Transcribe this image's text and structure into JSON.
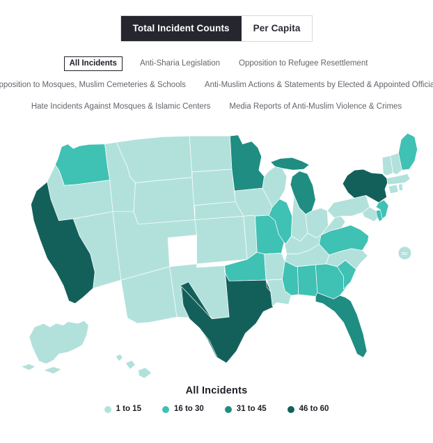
{
  "toggle": {
    "options": [
      {
        "label": "Total Incident Counts",
        "active": true
      },
      {
        "label": "Per Capita",
        "active": false
      }
    ]
  },
  "filters": {
    "rows": [
      [
        {
          "label": "All Incidents",
          "selected": true
        },
        {
          "label": "Anti-Sharia Legislation",
          "selected": false
        },
        {
          "label": "Opposition to Refugee Resettlement",
          "selected": false
        }
      ],
      [
        {
          "label": "Opposition to Mosques, Muslim Cemeteries & Schools",
          "selected": false
        },
        {
          "label": "Anti-Muslim Actions & Statements by Elected & Appointed Officials",
          "selected": false
        }
      ],
      [
        {
          "label": "Hate Incidents Against Mosques & Islamic Centers",
          "selected": false
        },
        {
          "label": "Media Reports of Anti-Muslim Violence & Crimes",
          "selected": false
        }
      ]
    ]
  },
  "legend": {
    "title": "All Incidents",
    "items": [
      {
        "label": "1 to 15",
        "color": "#b2e1dc"
      },
      {
        "label": "16 to 30",
        "color": "#3fc1b4"
      },
      {
        "label": "31 to 45",
        "color": "#1f8d82"
      },
      {
        "label": "46 to 60",
        "color": "#13605b"
      }
    ]
  },
  "map": {
    "dc_marker": {
      "label": "DC",
      "color": "#b2e1dc"
    },
    "colors": {
      "bin1": "#b2e1dc",
      "bin2": "#3fc1b4",
      "bin3": "#1f8d82",
      "bin4": "#13605b"
    }
  },
  "chart_data": {
    "type": "map",
    "title": "All Incidents",
    "measure": "Total Incident Counts",
    "bins": [
      {
        "label": "1 to 15",
        "min": 1,
        "max": 15,
        "color": "#b2e1dc"
      },
      {
        "label": "16 to 30",
        "min": 16,
        "max": 30,
        "color": "#3fc1b4"
      },
      {
        "label": "31 to 45",
        "min": 31,
        "max": 45,
        "color": "#1f8d82"
      },
      {
        "label": "46 to 60",
        "min": 46,
        "max": 60,
        "color": "#13605b"
      }
    ],
    "regions": [
      {
        "id": "AL",
        "name": "Alabama",
        "bin": "16 to 30"
      },
      {
        "id": "AK",
        "name": "Alaska",
        "bin": "1 to 15"
      },
      {
        "id": "AZ",
        "name": "Arizona",
        "bin": "1 to 15"
      },
      {
        "id": "AR",
        "name": "Arkansas",
        "bin": "1 to 15"
      },
      {
        "id": "CA",
        "name": "California",
        "bin": "46 to 60"
      },
      {
        "id": "CO",
        "name": "Colorado",
        "bin": "1 to 15"
      },
      {
        "id": "CT",
        "name": "Connecticut",
        "bin": "1 to 15"
      },
      {
        "id": "DE",
        "name": "Delaware",
        "bin": "16 to 30"
      },
      {
        "id": "DC",
        "name": "District of Columbia",
        "bin": "1 to 15"
      },
      {
        "id": "FL",
        "name": "Florida",
        "bin": "31 to 45"
      },
      {
        "id": "GA",
        "name": "Georgia",
        "bin": "16 to 30"
      },
      {
        "id": "HI",
        "name": "Hawaii",
        "bin": "1 to 15"
      },
      {
        "id": "ID",
        "name": "Idaho",
        "bin": "1 to 15"
      },
      {
        "id": "IL",
        "name": "Illinois",
        "bin": "16 to 30"
      },
      {
        "id": "IN",
        "name": "Indiana",
        "bin": "1 to 15"
      },
      {
        "id": "IA",
        "name": "Iowa",
        "bin": "1 to 15"
      },
      {
        "id": "KS",
        "name": "Kansas",
        "bin": "1 to 15"
      },
      {
        "id": "KY",
        "name": "Kentucky",
        "bin": "1 to 15"
      },
      {
        "id": "LA",
        "name": "Louisiana",
        "bin": "1 to 15"
      },
      {
        "id": "ME",
        "name": "Maine",
        "bin": "16 to 30"
      },
      {
        "id": "MD",
        "name": "Maryland",
        "bin": "1 to 15"
      },
      {
        "id": "MA",
        "name": "Massachusetts",
        "bin": "1 to 15"
      },
      {
        "id": "MI",
        "name": "Michigan",
        "bin": "31 to 45"
      },
      {
        "id": "MN",
        "name": "Minnesota",
        "bin": "31 to 45"
      },
      {
        "id": "MS",
        "name": "Mississippi",
        "bin": "16 to 30"
      },
      {
        "id": "MO",
        "name": "Missouri",
        "bin": "16 to 30"
      },
      {
        "id": "MT",
        "name": "Montana",
        "bin": "1 to 15"
      },
      {
        "id": "NE",
        "name": "Nebraska",
        "bin": "1 to 15"
      },
      {
        "id": "NV",
        "name": "Nevada",
        "bin": "1 to 15"
      },
      {
        "id": "NH",
        "name": "New Hampshire",
        "bin": "1 to 15"
      },
      {
        "id": "NJ",
        "name": "New Jersey",
        "bin": "16 to 30"
      },
      {
        "id": "NM",
        "name": "New Mexico",
        "bin": "1 to 15"
      },
      {
        "id": "NY",
        "name": "New York",
        "bin": "46 to 60"
      },
      {
        "id": "NC",
        "name": "North Carolina",
        "bin": "1 to 15"
      },
      {
        "id": "ND",
        "name": "North Dakota",
        "bin": "1 to 15"
      },
      {
        "id": "OH",
        "name": "Ohio",
        "bin": "1 to 15"
      },
      {
        "id": "OK",
        "name": "Oklahoma",
        "bin": "16 to 30"
      },
      {
        "id": "OR",
        "name": "Oregon",
        "bin": "1 to 15"
      },
      {
        "id": "PA",
        "name": "Pennsylvania",
        "bin": "1 to 15"
      },
      {
        "id": "RI",
        "name": "Rhode Island",
        "bin": "1 to 15"
      },
      {
        "id": "SC",
        "name": "South Carolina",
        "bin": "16 to 30"
      },
      {
        "id": "SD",
        "name": "South Dakota",
        "bin": "1 to 15"
      },
      {
        "id": "TN",
        "name": "Tennessee",
        "bin": "1 to 15"
      },
      {
        "id": "TX",
        "name": "Texas",
        "bin": "46 to 60"
      },
      {
        "id": "UT",
        "name": "Utah",
        "bin": "1 to 15"
      },
      {
        "id": "VT",
        "name": "Vermont",
        "bin": "1 to 15"
      },
      {
        "id": "VA",
        "name": "Virginia",
        "bin": "16 to 30"
      },
      {
        "id": "WA",
        "name": "Washington",
        "bin": "16 to 30"
      },
      {
        "id": "WV",
        "name": "West Virginia",
        "bin": "1 to 15"
      },
      {
        "id": "WI",
        "name": "Wisconsin",
        "bin": "1 to 15"
      },
      {
        "id": "WY",
        "name": "Wyoming",
        "bin": "1 to 15"
      }
    ]
  }
}
